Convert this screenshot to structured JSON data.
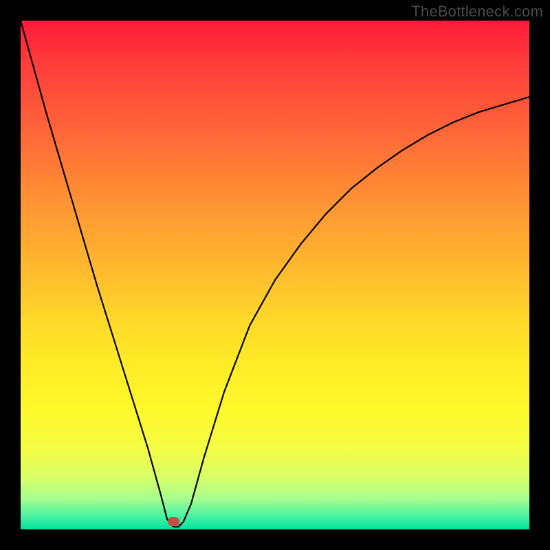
{
  "watermark": "TheBottleneck.com",
  "marker": {
    "x_pct": 30.0,
    "y_pct": 98.4
  },
  "chart_data": {
    "type": "line",
    "title": "",
    "xlabel": "",
    "ylabel": "",
    "xlim": [
      0,
      100
    ],
    "ylim": [
      0,
      100
    ],
    "grid": false,
    "legend": false,
    "note": "Values estimated from pixel positions; percent of plot extent.",
    "series": [
      {
        "name": "bottleneck-curve",
        "x": [
          0,
          5,
          10,
          15,
          20,
          25,
          27.5,
          28.8,
          30,
          31,
          32,
          33.5,
          36,
          40,
          45,
          50,
          55,
          60,
          65,
          70,
          75,
          80,
          85,
          90,
          95,
          100
        ],
        "y": [
          100,
          82,
          65,
          48,
          32,
          16,
          7,
          2,
          0.5,
          0.5,
          1.5,
          5,
          14,
          27,
          40,
          49,
          56,
          62,
          67,
          71,
          74.5,
          77.5,
          80,
          82,
          83.5,
          85
        ],
        "color": "#000000"
      }
    ],
    "marker_point": {
      "x": 30.0,
      "y": 1.6
    }
  }
}
